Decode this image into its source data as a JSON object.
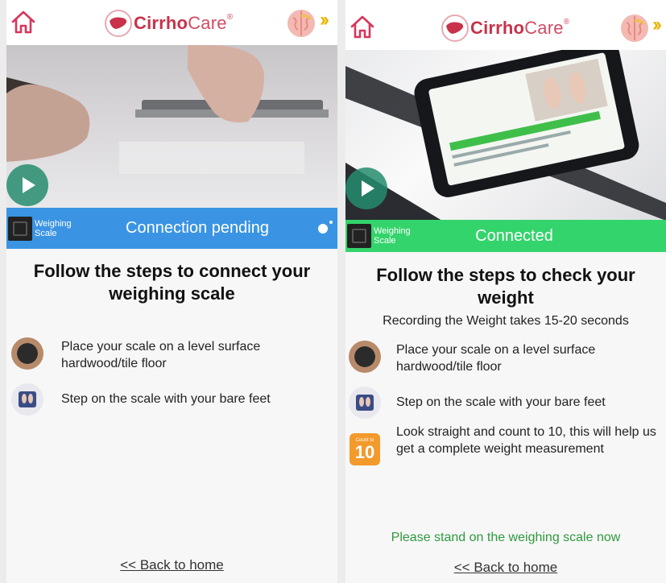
{
  "screens": [
    {
      "brand": {
        "strong": "Cirrho",
        "light": "Care",
        "reg": "®"
      },
      "status": {
        "device_label": "Weighing Scale",
        "text": "Connection pending",
        "color": "#3a94e3"
      },
      "title": "Follow the steps to connect your weighing scale",
      "steps": [
        {
          "icon": "scale-icon",
          "text": "Place your scale on a level surface hardwood/tile floor"
        },
        {
          "icon": "bare-feet-icon",
          "text": "Step on the scale with your bare feet"
        }
      ],
      "back_link": "<< Back to home"
    },
    {
      "brand": {
        "strong": "Cirrho",
        "light": "Care",
        "reg": "®"
      },
      "status": {
        "device_label": "Weighing Scale",
        "text": "Connected",
        "color": "#34d46c"
      },
      "title": "Follow the steps to check your weight",
      "subtitle": "Recording the Weight takes 15-20 seconds",
      "steps": [
        {
          "icon": "scale-icon",
          "text": "Place your scale on a level surface hardwood/tile floor"
        },
        {
          "icon": "bare-feet-icon",
          "text": "Step on the scale with your bare feet"
        },
        {
          "icon": "count-to-10-icon",
          "icon_caption": "Count to",
          "icon_number": "10",
          "text": "Look straight and count to 10, this will help us get a complete weight measurement"
        }
      ],
      "prompt": "Please stand on the weighing scale now",
      "back_link": "<< Back to home"
    }
  ]
}
